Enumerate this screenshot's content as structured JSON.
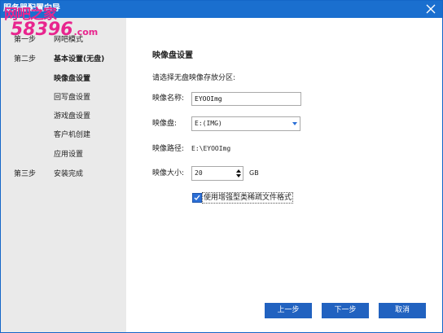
{
  "window": {
    "title": "服务器配置向导",
    "accent_color": "#1a6fcf",
    "close_icon": "close-icon"
  },
  "watermark": {
    "top_text": "网吧之家",
    "number_text": "58396",
    "domain_text": ".com"
  },
  "sidebar": {
    "steps": [
      {
        "step": "第一步",
        "label": "网吧模式"
      },
      {
        "step": "第二步",
        "label": "基本设置(无盘)"
      },
      {
        "step": "第三步",
        "label": "安装完成"
      }
    ],
    "sub_items": [
      "映像盘设置",
      "回写盘设置",
      "游戏盘设置",
      "客户机创建",
      "应用设置"
    ],
    "active_sub_item": "映像盘设置"
  },
  "main": {
    "section_title": "映像盘设置",
    "prompt": "请选择无盘映像存放分区:",
    "image_name_label": "映像名称:",
    "image_name_value": "EYOOImg",
    "image_disk_label": "映像盘:",
    "image_disk_value": "E:(IMG)",
    "image_path_label": "映像路径:",
    "image_path_value": "E:\\EYOOImg",
    "image_size_label": "映像大小:",
    "image_size_value": "20",
    "image_size_unit": "GB",
    "sparse_checkbox_label": "使用增强型类稀疏文件格式",
    "sparse_checkbox_checked": true
  },
  "footer": {
    "prev_label": "上一步",
    "next_label": "下一步",
    "cancel_label": "取消",
    "button_color": "#2162c0"
  }
}
